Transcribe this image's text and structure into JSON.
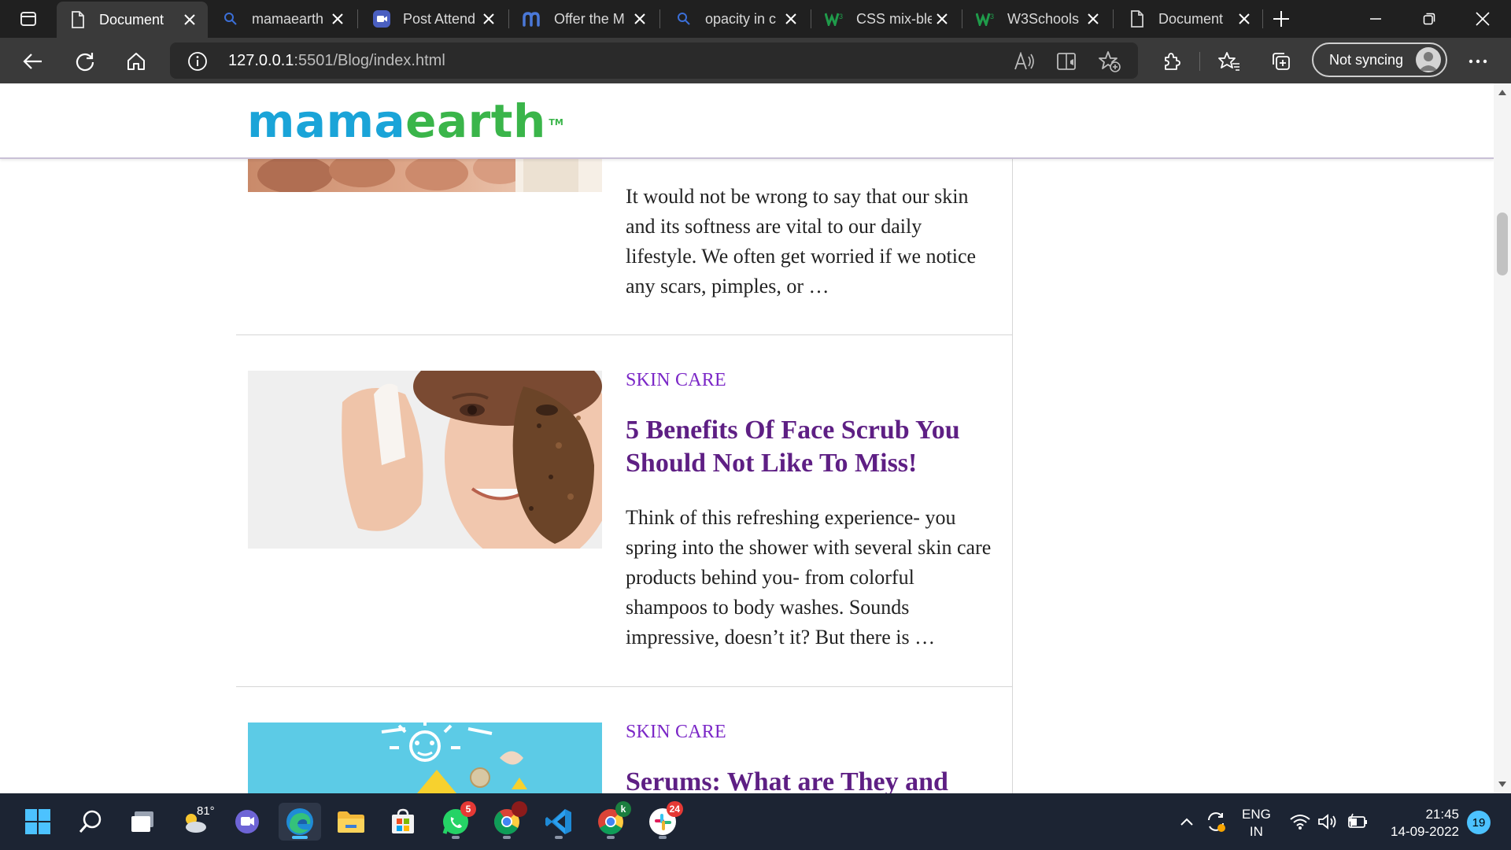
{
  "browser": {
    "tabs": [
      {
        "title": "Document",
        "icon": "page-icon",
        "active": true
      },
      {
        "title": "mamaearth",
        "icon": "search-icon",
        "active": false
      },
      {
        "title": "Post Attend",
        "icon": "video-call-icon",
        "active": false
      },
      {
        "title": "Offer the M",
        "icon": "m-logo-icon",
        "active": false
      },
      {
        "title": "opacity in c",
        "icon": "search-icon",
        "active": false
      },
      {
        "title": "CSS mix-ble",
        "icon": "w3schools-icon",
        "active": false
      },
      {
        "title": "W3Schools",
        "icon": "w3schools-icon",
        "active": false
      },
      {
        "title": "Document",
        "icon": "page-icon",
        "active": false
      }
    ],
    "address_host": "127.0.0.1",
    "address_path": ":5501/Blog/index.html",
    "sync_label": "Not syncing"
  },
  "site": {
    "logo_first": "mama",
    "logo_second": "earth",
    "logo_tm": "TM"
  },
  "posts": [
    {
      "category": "",
      "title": "",
      "excerpt": "It would not be wrong to say that our skin and its softness are vital to our daily lifestyle. We often get worried if we notice any scars, pimples, or …"
    },
    {
      "category": "SKIN CARE",
      "title": "5 Benefits Of Face Scrub You Should Not Like To Miss!",
      "excerpt": "Think of this refreshing experience- you spring into the shower with several skin care products behind you- from colorful shampoos to body washes. Sounds impressive, doesn’t it? But there is …"
    },
    {
      "category": "SKIN CARE",
      "title": "Serums: What are They and",
      "excerpt": ""
    }
  ],
  "taskbar": {
    "weather_temp": "81°",
    "whatsapp_badge": "5",
    "slack_badge": "24",
    "chrome_profile_badge": "k",
    "lang_line1": "ENG",
    "lang_line2": "IN",
    "time": "21:45",
    "date": "14-09-2022",
    "notifications": "19"
  },
  "colors": {
    "accent_purple": "#7b27c7",
    "title_purple": "#5e1f84",
    "logo_blue": "#1aa4d8",
    "logo_green": "#3ab54a",
    "taskbar_bg": "#1c2433"
  }
}
